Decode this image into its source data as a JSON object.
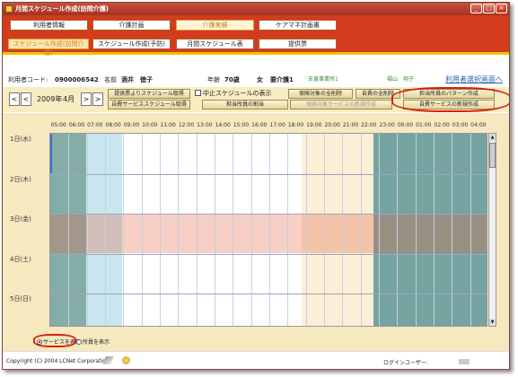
{
  "window": {
    "title": "月間スケジュール作成(訪問介護)",
    "controls": [
      "minimize",
      "maximize",
      "close"
    ]
  },
  "top_nav": {
    "row1": [
      {
        "label": "利用者情報",
        "active": false
      },
      {
        "label": "介護計画",
        "active": false
      },
      {
        "label": "介護実績",
        "active": true
      },
      {
        "label": "ケアマネ計画書",
        "active": false
      }
    ],
    "row2": [
      {
        "label": "スケジュール作成(訪問介護)",
        "active": true
      },
      {
        "label": "スケジュール作成(予防)",
        "active": false
      },
      {
        "label": "月間スケジュール表",
        "active": false
      },
      {
        "label": "提供票",
        "active": false
      }
    ]
  },
  "user_info": {
    "code_label": "利用者コード:",
    "code": "0900006542",
    "name_label": "名前",
    "name": "酒井　徳子",
    "age_label": "年齢",
    "age": "70歳",
    "gender": "女",
    "care_level": "要介護1",
    "office": "支援事業所1",
    "manager": "福山　翔子",
    "select_link": "利用者選択画面へ"
  },
  "controls": {
    "prev_prev": "<",
    "prev": "<",
    "year": "2009年",
    "month": "4月",
    "next": ">",
    "next_next": ">",
    "btn_get_schedule": "提供票よりスケジュール取得",
    "btn_get_own_service": "自費サービススケジュール取得",
    "chk_show_cancelled": "中止スケジュールの表示",
    "btn_delete_insured": "保険対象の全削除",
    "btn_assign_staff": "担当所員の割当",
    "btn_new_insured": "保険対象サービスの新規作成",
    "btn_delete_own": "自費の全削除",
    "btn_staff_pattern": "担当所員のパターン作成",
    "btn_new_own_service": "自費サービスの新規作成"
  },
  "schedule": {
    "hours": [
      "05:00",
      "06:00",
      "07:00",
      "08:00",
      "09:00",
      "10:00",
      "11:00",
      "12:00",
      "13:00",
      "14:00",
      "15:00",
      "16:00",
      "17:00",
      "18:00",
      "19:00",
      "20:00",
      "21:00",
      "22:00",
      "23:00",
      "00:00",
      "01:00",
      "02:00",
      "03:00",
      "04:00"
    ],
    "days": [
      "1日(水)",
      "2日(木)",
      "3日(金)",
      "4日(土)",
      "5日(日)"
    ]
  },
  "bottom": {
    "opt_service": "サービスを表示",
    "opt_staff": "所員を表示"
  },
  "status": {
    "copyright": "Copyright (C) 2004 LCNet Corporation",
    "login_label": "ログインユーザー:"
  },
  "colors": {
    "title_red": "#a5301f",
    "nav_red": "#d23c1c",
    "nav_yellow": "#f2c000",
    "panel_beige": "#f6e8bf",
    "highlight_ring": "#d9200f",
    "early_band": "#6f9f99",
    "morning_band": "#c9e6ee",
    "evening_band": "#fbefd6",
    "night_band": "#5d938f",
    "friday_row": "#f5c9b8"
  }
}
